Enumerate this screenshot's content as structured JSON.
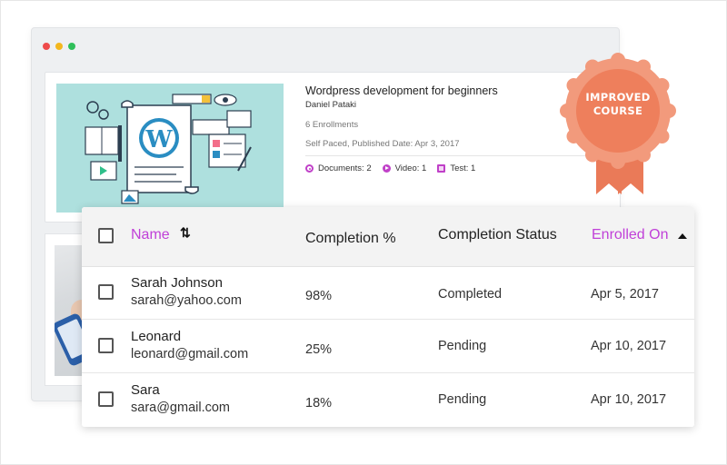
{
  "course": {
    "title": "Wordpress development for beginners",
    "author": "Daniel Pataki",
    "enrollments": "6 Enrollments",
    "meta": "Self Paced, Published Date: Apr 3, 2017",
    "stats": {
      "documents": "Documents: 2",
      "video": "Video: 1",
      "test": "Test: 1"
    }
  },
  "badge": {
    "line1": "IMPROVED",
    "line2": "COURSE",
    "color": "#f08a6a"
  },
  "table": {
    "headers": {
      "name": "Name",
      "completion_pct": "Completion %",
      "completion_status": "Completion Status",
      "enrolled_on": "Enrolled On"
    },
    "rows": [
      {
        "name": "Sarah Johnson",
        "email": "sarah@yahoo.com",
        "pct": "98%",
        "status": "Completed",
        "date": "Apr 5, 2017"
      },
      {
        "name": "Leonard",
        "email": "leonard@gmail.com",
        "pct": "25%",
        "status": "Pending",
        "date": "Apr 10, 2017"
      },
      {
        "name": "Sara",
        "email": "sara@gmail.com",
        "pct": "18%",
        "status": "Pending",
        "date": "Apr 10, 2017"
      }
    ]
  },
  "colors": {
    "accent": "#c040d8",
    "thumb_bg": "#aee0de",
    "wordpress_blue": "#2a8dc2"
  },
  "icons": {
    "sort": "sort-arrows-icon",
    "ascending": "caret-up-icon",
    "documents": "document-icon",
    "video": "play-icon",
    "test": "test-icon"
  }
}
